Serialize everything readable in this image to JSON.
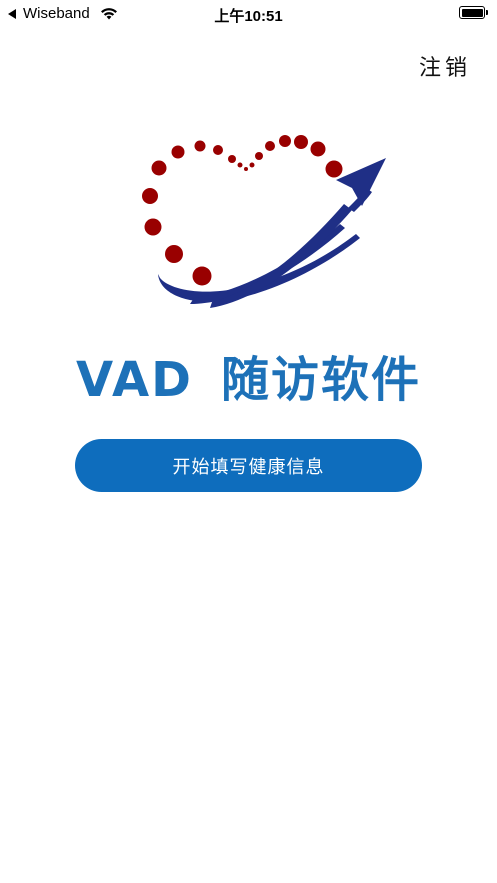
{
  "status_bar": {
    "carrier": "Wiseband",
    "time": "上午10:51",
    "icons": [
      "back-arrow-icon",
      "wifi-icon",
      "battery-icon"
    ]
  },
  "header": {
    "logout_label": "注销"
  },
  "logo": {
    "brand": "VAD",
    "subtitle": "随访软件",
    "dot_color": "#990000",
    "arrow_color": "#1f2f86"
  },
  "main": {
    "start_button_label": "开始填写健康信息",
    "button_color": "#0e6dbd"
  }
}
